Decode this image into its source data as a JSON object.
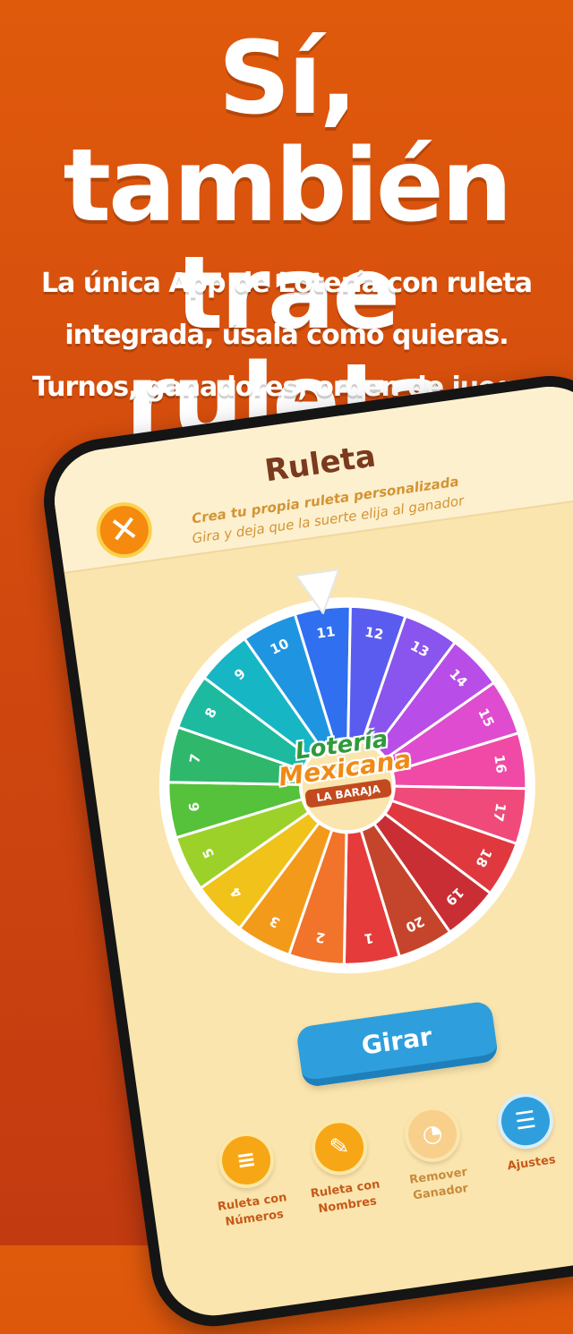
{
  "hero": {
    "headline_line1": "Sí, también",
    "headline_line2": "trae ruleta",
    "sub_line1": "La única App de Lotería con ruleta",
    "sub_line2": "integrada, úsala como quieras.",
    "sub_line3": "Turnos, ganadores, orden de juego."
  },
  "screen": {
    "title": "Ruleta",
    "subtitle": "Crea tu propia ruleta personalizada",
    "caption": "Gira y deja que la suerte elija al ganador",
    "close_icon": "close-icon"
  },
  "wheel": {
    "segments": [
      "1",
      "2",
      "3",
      "4",
      "5",
      "6",
      "7",
      "8",
      "9",
      "10",
      "11",
      "12",
      "13",
      "14",
      "15",
      "16",
      "17",
      "18",
      "19",
      "20"
    ],
    "colors": [
      "#e53b3b",
      "#f2732a",
      "#f39a1b",
      "#f0c21a",
      "#9cd12a",
      "#56c13a",
      "#2fb86b",
      "#1dbaa0",
      "#17b6c4",
      "#1f95e2",
      "#2f6ff0",
      "#5a5cf0",
      "#8a54ee",
      "#b84de8",
      "#df4ccf",
      "#f04aa6",
      "#f04a7a",
      "#e0383f",
      "#c92e34",
      "#c4452b"
    ],
    "logo_line1": "Lotería",
    "logo_line2": "Mexicana",
    "logo_badge": "LA BARAJA"
  },
  "actions": {
    "spin_label": "Girar",
    "items": [
      {
        "label1": "Ruleta con",
        "label2": "Números",
        "icon": "numbered-list-icon",
        "color": "#f7a716"
      },
      {
        "label1": "Ruleta con",
        "label2": "Nombres",
        "icon": "signature-icon",
        "color": "#f7a716"
      },
      {
        "label1": "Remover",
        "label2": "Ganador",
        "icon": "pie-chart-icon",
        "color": "#f8d08c"
      },
      {
        "label1": "Ajustes",
        "label2": "",
        "icon": "sliders-icon",
        "color": "#2e9fdc"
      }
    ]
  }
}
